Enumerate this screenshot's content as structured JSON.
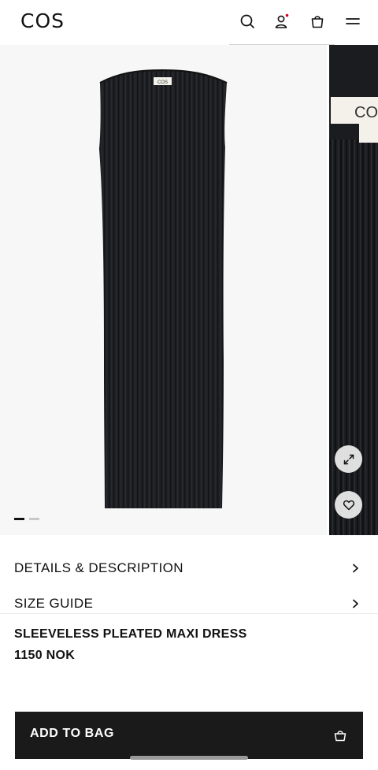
{
  "header": {
    "logo": "COS",
    "icons": [
      "search-icon",
      "account-icon",
      "bag-icon",
      "menu-icon"
    ],
    "notification_color": "#d0021b"
  },
  "gallery": {
    "main_label": "COS",
    "slide_index": 1,
    "slide_count": 2,
    "actions": [
      "expand-icon",
      "heart-icon"
    ]
  },
  "accordions": [
    {
      "label": "DETAILS & DESCRIPTION"
    },
    {
      "label": "SIZE GUIDE"
    }
  ],
  "product": {
    "name": "SLEEVELESS PLEATED MAXI DRESS",
    "price": "1150 NOK"
  },
  "cta": {
    "label": "ADD TO BAG",
    "background": "#1a1a1a",
    "text_color": "#ffffff"
  }
}
